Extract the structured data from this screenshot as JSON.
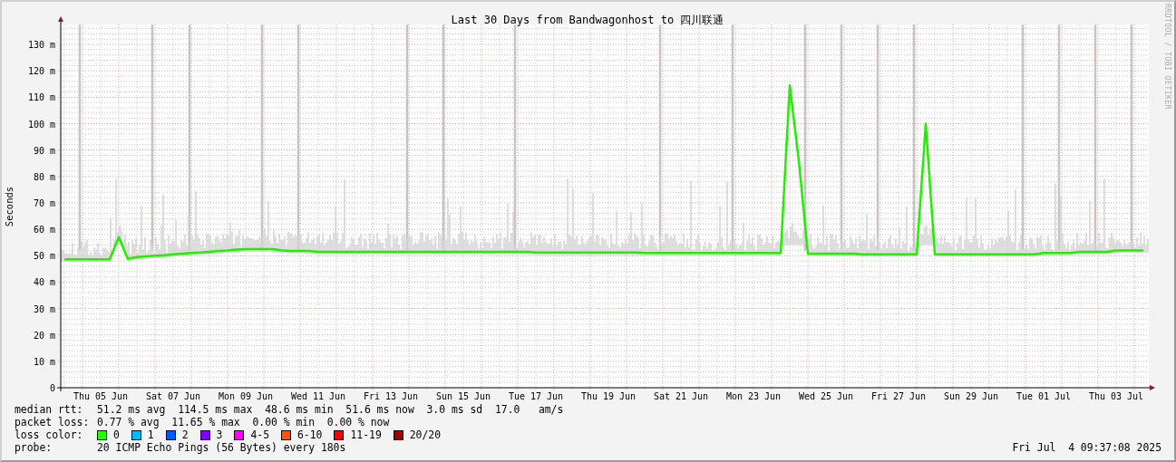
{
  "chart": {
    "chart_data": {
      "type": "line",
      "title": "Last 30 Days from Bandwagonhost to 四川联通",
      "ylabel": "Seconds",
      "ylim": [
        0,
        137.5
      ],
      "grid": true,
      "yticks": [
        {
          "value": 0,
          "label": "0"
        },
        {
          "value": 10,
          "label": "10 m"
        },
        {
          "value": 20,
          "label": "20 m"
        },
        {
          "value": 30,
          "label": "30 m"
        },
        {
          "value": 40,
          "label": "40 m"
        },
        {
          "value": 50,
          "label": "50 m"
        },
        {
          "value": 60,
          "label": "60 m"
        },
        {
          "value": 70,
          "label": "70 m"
        },
        {
          "value": 80,
          "label": "80 m"
        },
        {
          "value": 90,
          "label": "90 m"
        },
        {
          "value": 100,
          "label": "100 m"
        },
        {
          "value": 110,
          "label": "110 m"
        },
        {
          "value": 120,
          "label": "120 m"
        },
        {
          "value": 130,
          "label": "130 m"
        }
      ],
      "categories": [
        null,
        null,
        null,
        null,
        "Thu 05 Jun",
        null,
        null,
        null,
        null,
        null,
        null,
        null,
        "Sat 07 Jun",
        null,
        null,
        null,
        null,
        null,
        null,
        null,
        "Mon 09 Jun",
        null,
        null,
        null,
        null,
        null,
        null,
        null,
        "Wed 11 Jun",
        null,
        null,
        null,
        null,
        null,
        null,
        null,
        "Fri 13 Jun",
        null,
        null,
        null,
        null,
        null,
        null,
        null,
        "Sun 15 Jun",
        null,
        null,
        null,
        null,
        null,
        null,
        null,
        "Tue 17 Jun",
        null,
        null,
        null,
        null,
        null,
        null,
        null,
        "Thu 19 Jun",
        null,
        null,
        null,
        null,
        null,
        null,
        null,
        "Sat 21 Jun",
        null,
        null,
        null,
        null,
        null,
        null,
        null,
        "Mon 23 Jun",
        null,
        null,
        null,
        null,
        null,
        null,
        null,
        "Wed 25 Jun",
        null,
        null,
        null,
        null,
        null,
        null,
        null,
        "Fri 27 Jun",
        null,
        null,
        null,
        null,
        null,
        null,
        null,
        "Sun 29 Jun",
        null,
        null,
        null,
        null,
        null,
        null,
        null,
        "Tue 01 Jul",
        null,
        null,
        null,
        null,
        null,
        null,
        null,
        "Thu 03 Jul",
        null,
        null,
        null
      ],
      "series": [
        {
          "name": "median rtt:",
          "color": "#22ee00",
          "values": [
            48.6,
            48.6,
            48.6,
            48.6,
            48.6,
            48.6,
            57,
            48.8,
            49.5,
            49.7,
            50,
            50.2,
            50.5,
            50.8,
            51,
            51.2,
            51.5,
            51.8,
            52,
            52.3,
            52.5,
            52.5,
            52.5,
            52.5,
            52,
            51.8,
            51.8,
            51.8,
            51.5,
            51.5,
            51.5,
            51.5,
            51.5,
            51.5,
            51.5,
            51.5,
            51.5,
            51.5,
            51.5,
            51.5,
            51.5,
            51.5,
            51.5,
            51.5,
            51.5,
            51.5,
            51.5,
            51.5,
            51.5,
            51.5,
            51.5,
            51.5,
            51.2,
            51.2,
            51.2,
            51.2,
            51.2,
            51.2,
            51.2,
            51.2,
            51.2,
            51.2,
            51.2,
            51.2,
            51,
            51,
            51,
            51,
            51,
            51,
            51,
            51,
            51,
            51,
            51,
            51,
            51,
            51,
            51,
            51,
            114.5,
            86,
            50.8,
            50.8,
            50.8,
            50.8,
            50.8,
            50.8,
            50.5,
            50.5,
            50.5,
            50.5,
            50.5,
            50.5,
            50.5,
            100,
            50.5,
            50.5,
            50.5,
            50.5,
            50.5,
            50.5,
            50.5,
            50.5,
            50.5,
            50.5,
            50.5,
            50.5,
            51,
            51,
            51,
            51,
            51.5,
            51.5,
            51.5,
            51.5,
            52,
            52,
            52,
            52
          ]
        }
      ]
    },
    "side_label": "RRDTOOL / TOBI OETIKER"
  },
  "legend": {
    "rows": [
      {
        "text": "51.2 ms avg  114.5 ms max  48.6 ms min  51.6 ms now  3.0 ms sd  17.0   am/s"
      },
      {
        "label": "packet loss:",
        "text": "0.77 % avg  11.65 % max  0.00 % min  0.00 % now"
      }
    ],
    "loss_color": {
      "label": "loss color:",
      "items": [
        {
          "label": "0",
          "color": "#26ff00"
        },
        {
          "label": "1",
          "color": "#00b8ff"
        },
        {
          "label": "2",
          "color": "#0059ff"
        },
        {
          "label": "3",
          "color": "#7e00ff"
        },
        {
          "label": "4-5",
          "color": "#ff00ff"
        },
        {
          "label": "6-10",
          "color": "#ff5500"
        },
        {
          "label": "11-19",
          "color": "#ff0000"
        },
        {
          "label": "20/20",
          "color": "#a10000"
        }
      ]
    },
    "probe": {
      "label": "probe:",
      "text": "20 ICMP Echo Pings (56 Bytes) every 180s",
      "timestamp": "Fri Jul  4 09:37:08 2025"
    }
  }
}
